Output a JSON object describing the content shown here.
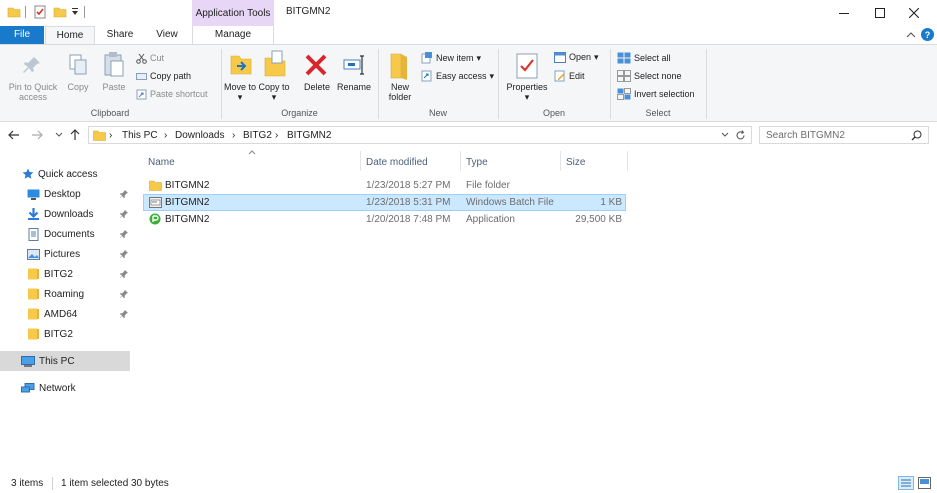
{
  "window": {
    "title": "BITGMN2",
    "context_tab_header": "Application Tools"
  },
  "tabs": [
    "File",
    "Home",
    "Share",
    "View",
    "Manage"
  ],
  "ribbon": {
    "clipboard": {
      "pin_to_quick_access": "Pin to Quick access",
      "copy": "Copy",
      "paste": "Paste",
      "cut": "Cut",
      "copy_path": "Copy path",
      "paste_shortcut": "Paste shortcut",
      "group_label": "Clipboard"
    },
    "organize": {
      "move_to": "Move to",
      "copy_to": "Copy to",
      "delete": "Delete",
      "rename": "Rename",
      "group_label": "Organize"
    },
    "new": {
      "new_folder": "New folder",
      "new_item": "New item",
      "easy_access": "Easy access",
      "group_label": "New"
    },
    "open": {
      "properties": "Properties",
      "open": "Open",
      "edit": "Edit",
      "group_label": "Open"
    },
    "select": {
      "select_all": "Select all",
      "select_none": "Select none",
      "invert_selection": "Invert selection",
      "group_label": "Select"
    }
  },
  "address": {
    "breadcrumbs": [
      "This PC",
      "Downloads",
      "BITG2",
      "BITGMN2"
    ],
    "search_placeholder": "Search BITGMN2"
  },
  "nav": {
    "quick_access": "Quick access",
    "items": [
      "Desktop",
      "Downloads",
      "Documents",
      "Pictures",
      "BITG2",
      "Roaming",
      "AMD64",
      "BITG2"
    ],
    "this_pc": "This PC",
    "network": "Network"
  },
  "columns": {
    "name": "Name",
    "date_modified": "Date modified",
    "type": "Type",
    "size": "Size"
  },
  "files": [
    {
      "name": "BITGMN2",
      "date": "1/23/2018 5:27 PM",
      "type": "File folder",
      "size": "",
      "icon": "folder-icon"
    },
    {
      "name": "BITGMN2",
      "date": "1/23/2018 5:31 PM",
      "type": "Windows Batch File",
      "size": "1 KB",
      "icon": "batch-file-icon"
    },
    {
      "name": "BITGMN2",
      "date": "1/20/2018 7:48 PM",
      "type": "Application",
      "size": "29,500 KB",
      "icon": "application-icon"
    }
  ],
  "status": {
    "item_count": "3 items",
    "selection": "1 item selected",
    "selection_size": "30 bytes"
  },
  "colors": {
    "file_tab": "#1979ca",
    "context_tab": "#e8d6f6",
    "selection": "#cce8ff",
    "folder": "#f7c94b"
  }
}
